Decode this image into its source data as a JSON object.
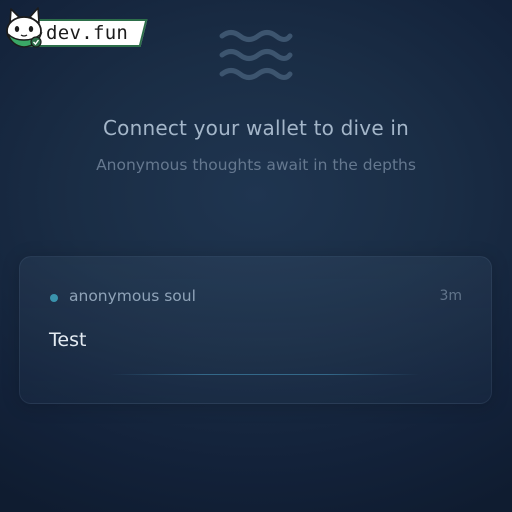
{
  "brand": {
    "name": "dev.fun",
    "colors": {
      "tag_bg": "#ffffff",
      "tag_border": "#2d6e4a",
      "mascot_green": "#3aa866"
    }
  },
  "hero": {
    "icon": "waves-icon",
    "title": "Connect your wallet to dive in",
    "subtitle": "Anonymous thoughts await in the depths"
  },
  "post": {
    "author": "anonymous soul",
    "time": "3m",
    "message": "Test",
    "accent": "#3a93ad"
  }
}
